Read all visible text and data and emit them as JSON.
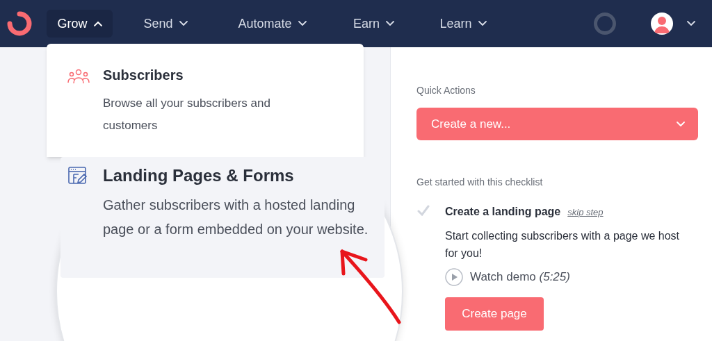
{
  "nav": {
    "items": [
      {
        "label": "Grow",
        "selected": true
      },
      {
        "label": "Send",
        "selected": false
      },
      {
        "label": "Automate",
        "selected": false
      },
      {
        "label": "Earn",
        "selected": false
      },
      {
        "label": "Learn",
        "selected": false
      }
    ]
  },
  "menu": {
    "items": [
      {
        "kind": "people",
        "title": "Subscribers",
        "description": "Browse all your subscribers and customers",
        "magnified": false
      },
      {
        "kind": "form",
        "title": "Landing Pages & Forms",
        "description": "Gather subscribers with a hosted landing page or a form embedded on your website.",
        "magnified": true
      }
    ]
  },
  "quick_actions": {
    "heading": "Quick Actions",
    "select": "Create a new..."
  },
  "checklist": {
    "heading": "Get started with this checklist",
    "items": [
      {
        "title": "Create a landing page",
        "done": false,
        "skip": "skip step",
        "description": "Start collecting subscribers with a page we host for you!",
        "demo": "Watch demo *(5:25)*",
        "button": "Create page"
      }
    ]
  }
}
